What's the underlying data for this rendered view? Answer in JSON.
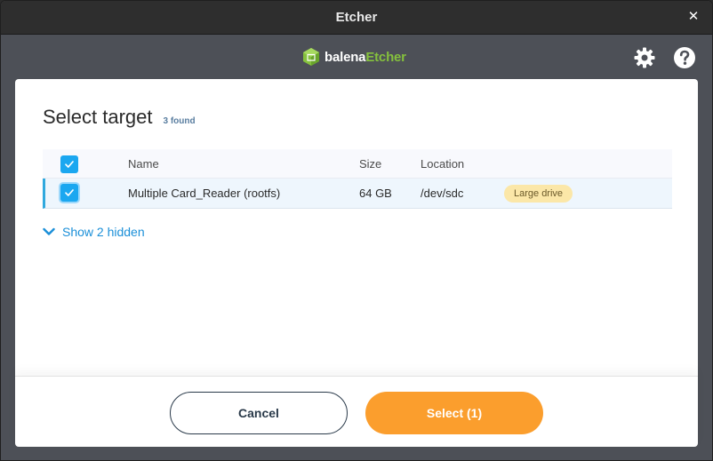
{
  "window": {
    "title": "Etcher",
    "close_glyph": "✕"
  },
  "header": {
    "logo_text_prefix": "balena",
    "logo_text_accent": "Etcher",
    "icons": [
      "gear-icon",
      "help-icon"
    ]
  },
  "modal": {
    "title": "Select target",
    "count": "3 found",
    "table": {
      "columns": [
        "Name",
        "Size",
        "Location"
      ],
      "rows": [
        {
          "name": "Multiple Card_Reader (rootfs)",
          "size": "64 GB",
          "location": "/dev/sdc",
          "badge": "Large drive",
          "checked": true
        }
      ]
    },
    "show_hidden": "Show 2 hidden",
    "buttons": {
      "cancel": "Cancel",
      "select": "Select (1)"
    }
  },
  "colors": {
    "accent": "#1ba7f0",
    "brand_green": "#85c13d",
    "primary_button": "#fb9e2d",
    "badge_bg": "#fbe7a8"
  }
}
